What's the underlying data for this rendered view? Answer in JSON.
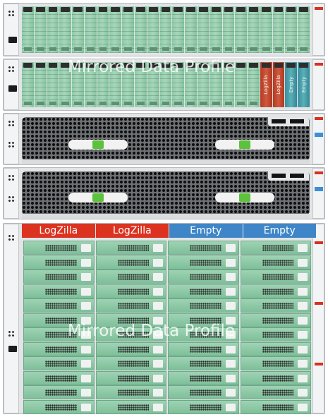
{
  "shelf1": {
    "bays": 23
  },
  "shelf2": {
    "overlay_text": "Mirrored Data Profile",
    "special_bays": [
      "LogZilla",
      "LogZilla",
      "Empty",
      "Empty"
    ]
  },
  "jbod": {
    "columns": [
      {
        "label": "LogZilla",
        "color": "#dc3320"
      },
      {
        "label": "LogZilla",
        "color": "#dc3320"
      },
      {
        "label": "Empty",
        "color": "#3e86c8"
      },
      {
        "label": "Empty",
        "color": "#3e86c8"
      }
    ],
    "rows": 12,
    "overlay_text": "Mirrored Data Profile"
  },
  "colors": {
    "drive_green": "#8fcaa6",
    "logzilla_red": "#dc3320",
    "empty_blue": "#3e86c8"
  }
}
